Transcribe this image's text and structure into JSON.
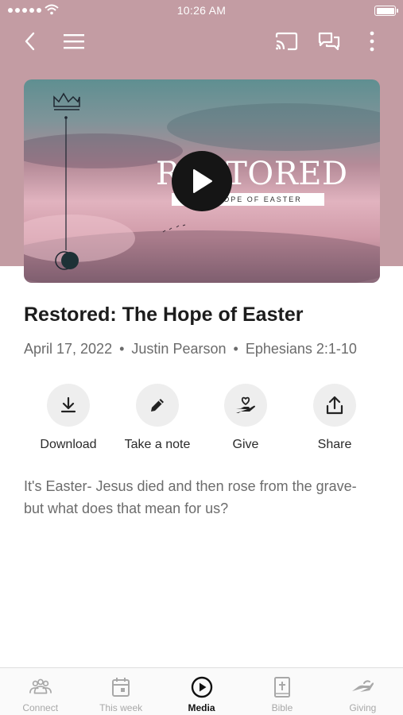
{
  "status_bar": {
    "time": "10:26 AM"
  },
  "nav": {
    "back_icon": "chevron-left-icon",
    "menu_icon": "hamburger-menu-icon",
    "cast_icon": "cast-icon",
    "chat_icon": "chat-bubbles-icon",
    "more_icon": "more-vertical-icon"
  },
  "video": {
    "title_text": "RESTORED",
    "subtitle_text": "THE HOPE OF EASTER",
    "play_icon": "play-icon"
  },
  "sermon": {
    "title": "Restored: The Hope of Easter",
    "date": "April 17, 2022",
    "speaker": "Justin Pearson",
    "scripture": "Ephesians 2:1-10",
    "separator": "•",
    "description": "It's Easter- Jesus died and then rose from the grave- but what does that mean for us?"
  },
  "actions": [
    {
      "label": "Download",
      "icon": "download-icon"
    },
    {
      "label": "Take a note",
      "icon": "pencil-icon"
    },
    {
      "label": "Give",
      "icon": "heart-hand-icon"
    },
    {
      "label": "Share",
      "icon": "share-icon"
    }
  ],
  "tabs": [
    {
      "label": "Connect",
      "icon": "people-icon",
      "active": false
    },
    {
      "label": "This week",
      "icon": "calendar-icon",
      "active": false
    },
    {
      "label": "Media",
      "icon": "play-circle-icon",
      "active": true
    },
    {
      "label": "Bible",
      "icon": "bible-icon",
      "active": false
    },
    {
      "label": "Giving",
      "icon": "giving-hand-icon",
      "active": false
    }
  ],
  "colors": {
    "header_background": "#c39ca3",
    "action_circle": "#eeeeee",
    "active_tab": "#111111",
    "inactive_tab": "#a8a8a8"
  }
}
